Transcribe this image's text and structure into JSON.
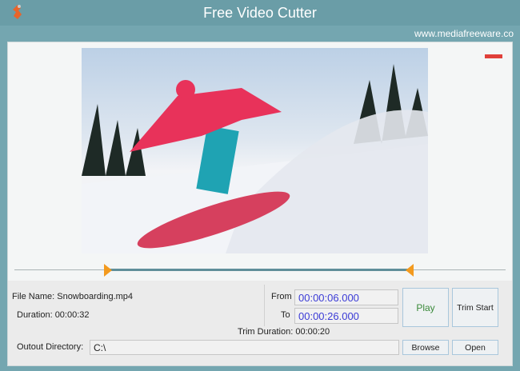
{
  "window": {
    "title": "Free Video Cutter",
    "website": "www.mediafreeware.co"
  },
  "file": {
    "name_label": "File Name: Snowboarding.mp4",
    "duration_label": "Duration: 00:00:32"
  },
  "trim": {
    "from_label": "From",
    "from_value": "00:00:06.000",
    "to_label": "To",
    "to_value": "00:00:26.000",
    "duration_label": "Trim Duration: 00:00:20",
    "start_fraction": 0.1875,
    "end_fraction": 0.8125
  },
  "buttons": {
    "play": "Play",
    "trim_start": "Trim Start",
    "browse": "Browse",
    "open": "Open"
  },
  "output": {
    "label": "Outout Directory:",
    "value": "C:\\"
  },
  "colors": {
    "accent": "#6a9da7",
    "handle": "#f39a1e",
    "play_text": "#3a8a3a"
  }
}
